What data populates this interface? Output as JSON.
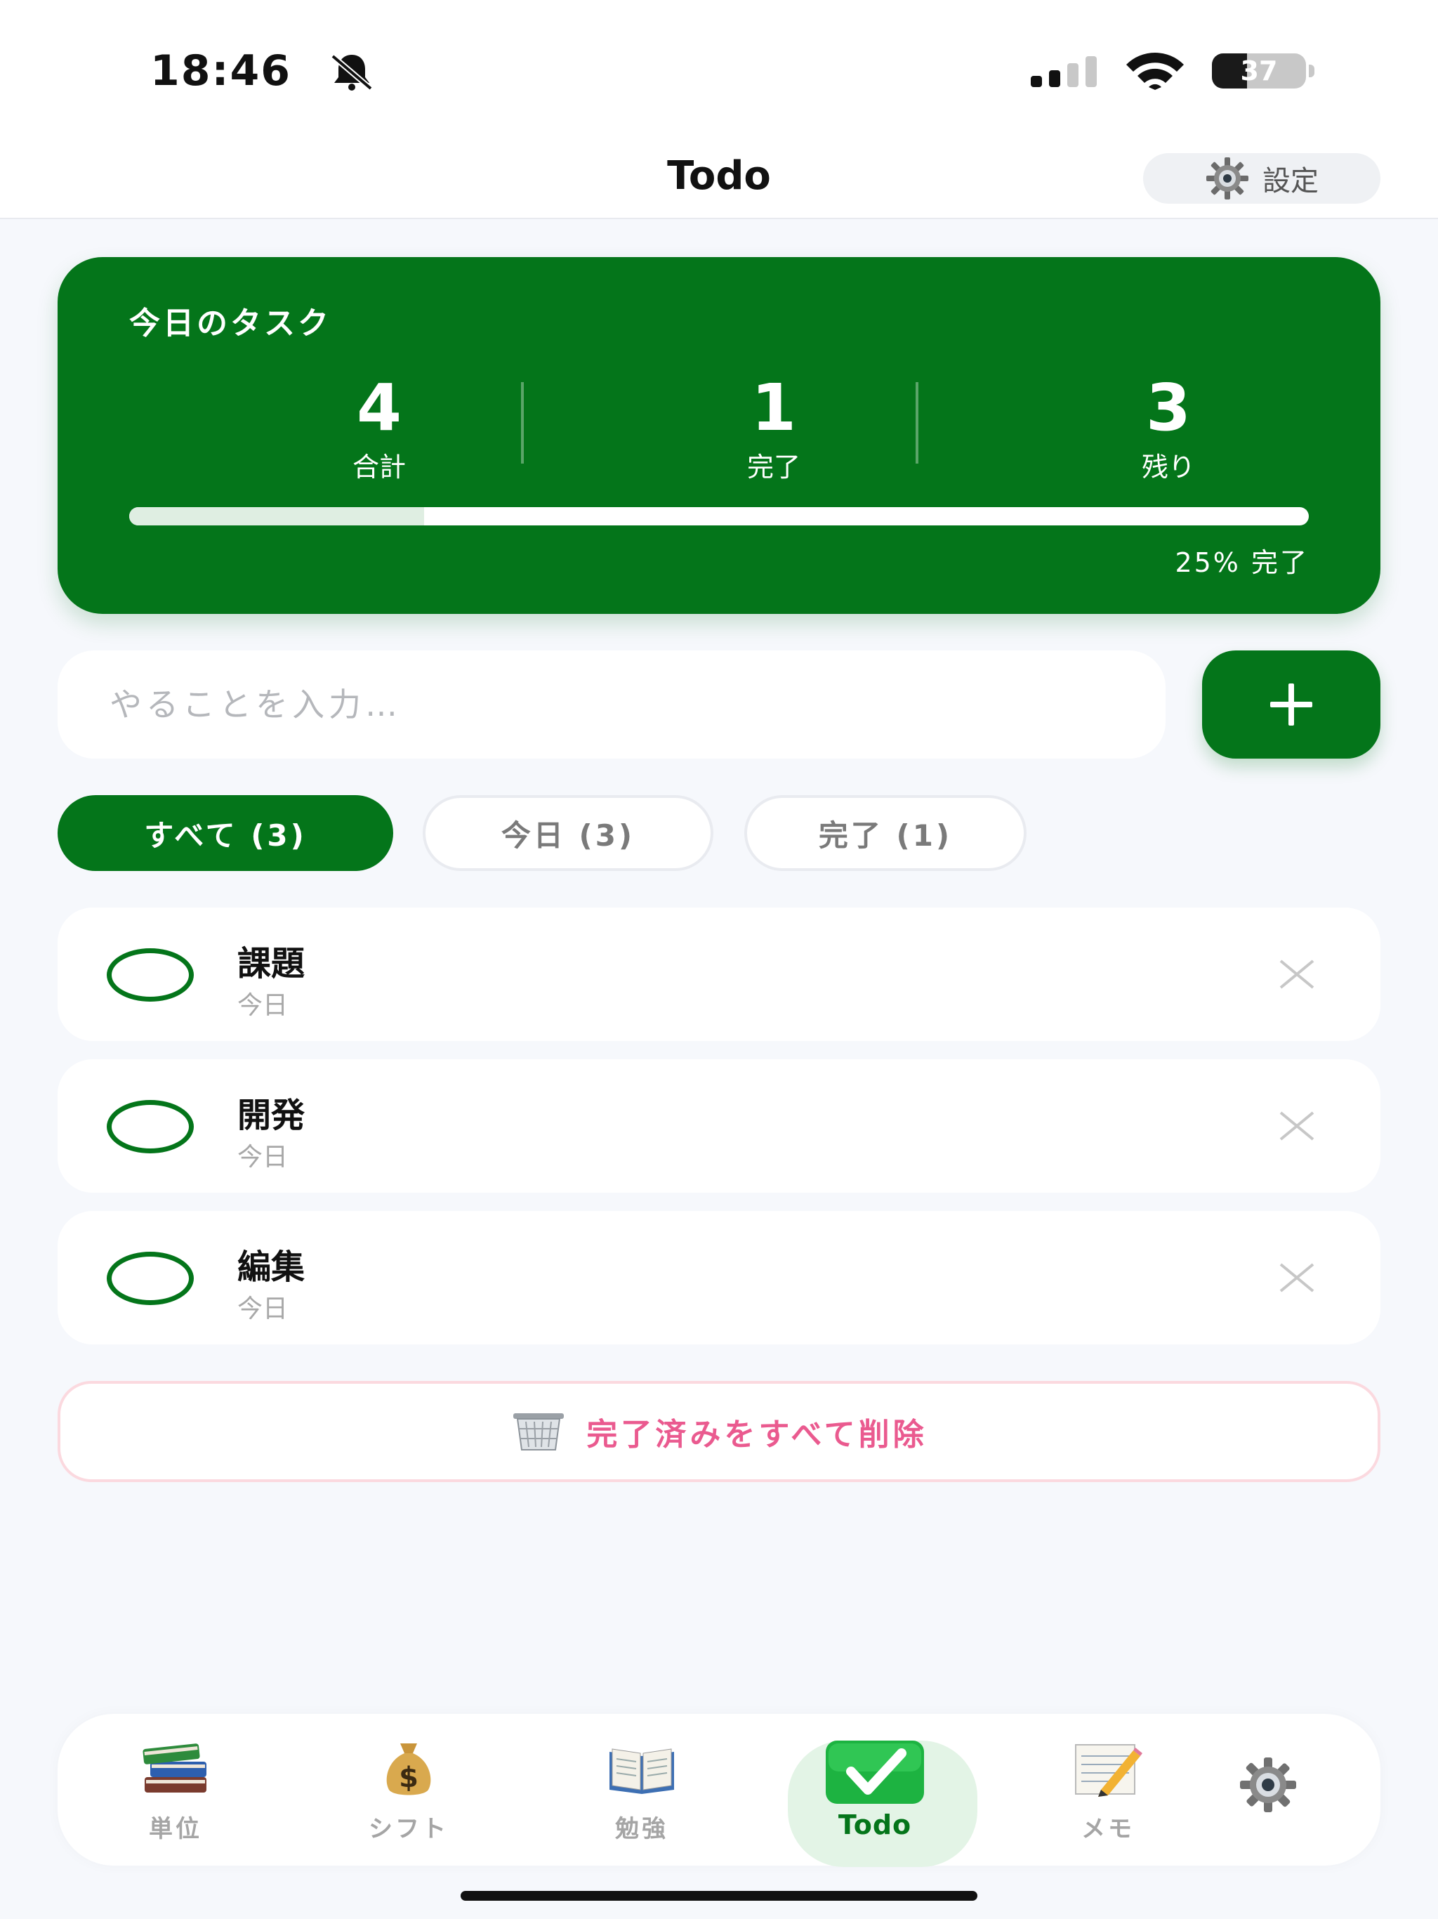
{
  "status_bar": {
    "time": "18:46",
    "battery_level": "37",
    "battery_fraction": 0.37
  },
  "header": {
    "title": "Todo",
    "settings_label": "設定"
  },
  "summary": {
    "title": "今日のタスク",
    "stats": [
      {
        "value": "4",
        "label": "合計"
      },
      {
        "value": "1",
        "label": "完了"
      },
      {
        "value": "3",
        "label": "残り"
      }
    ],
    "progress_fraction": 0.25,
    "progress_text": "25% 完了"
  },
  "input": {
    "placeholder": "やることを入力…",
    "value": ""
  },
  "filters": [
    {
      "label": "すべて (3)",
      "active": true
    },
    {
      "label": "今日 (3)",
      "active": false
    },
    {
      "label": "完了 (1)",
      "active": false
    }
  ],
  "tasks": [
    {
      "title": "課題",
      "subtitle": "今日",
      "done": false
    },
    {
      "title": "開発",
      "subtitle": "今日",
      "done": false
    },
    {
      "title": "編集",
      "subtitle": "今日",
      "done": false
    }
  ],
  "clear_completed_label": "完了済みをすべて削除",
  "nav": [
    {
      "label": "単位",
      "icon": "books-icon"
    },
    {
      "label": "シフト",
      "icon": "money-bag-icon"
    },
    {
      "label": "勉強",
      "icon": "open-book-icon"
    },
    {
      "label": "Todo",
      "icon": "check-icon",
      "active": true
    },
    {
      "label": "メモ",
      "icon": "memo-icon"
    },
    {
      "label": "",
      "icon": "gear-icon"
    }
  ],
  "colors": {
    "accent": "#04751a",
    "danger": "#ea5a8f",
    "background": "#f6f8fc"
  }
}
